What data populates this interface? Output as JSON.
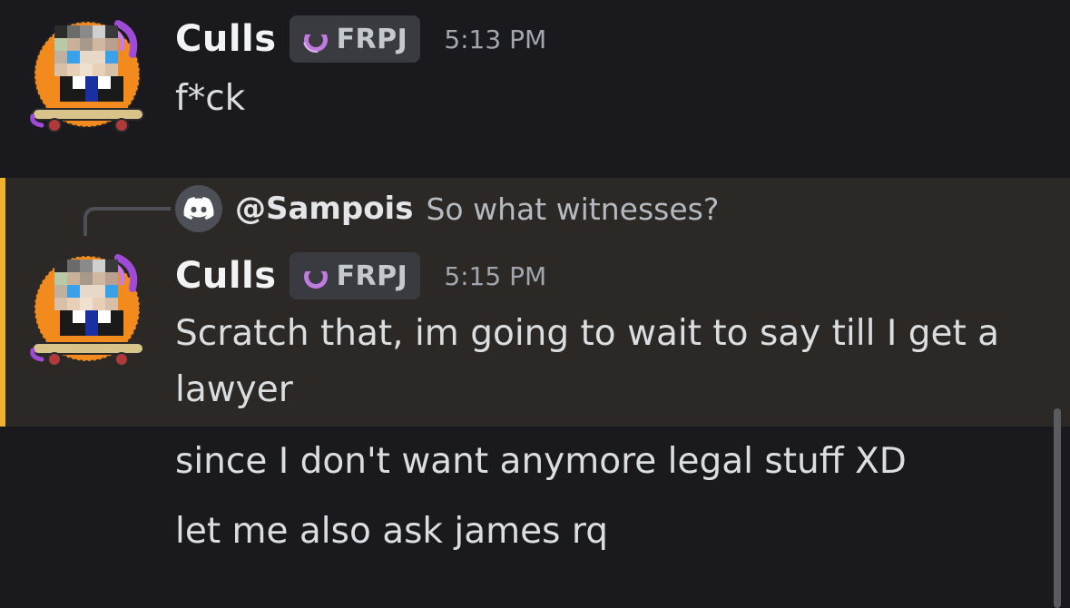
{
  "messages": [
    {
      "author": "Culls",
      "tag": "FRPJ",
      "timestamp": "5:13 PM",
      "text": "f*ck"
    },
    {
      "reply_to": {
        "mention": "@Sampois",
        "preview": "So what witnesses?",
        "avatar_icon": "discord-logo-icon"
      },
      "author": "Culls",
      "tag": "FRPJ",
      "timestamp": "5:15 PM",
      "text": "Scratch that, im going to wait to say till I get a lawyer",
      "highlight_color": "#f0b232"
    }
  ],
  "continuation_messages": [
    "since I don't want anymore legal stuff XD",
    "let me also ask james rq"
  ],
  "colors": {
    "background": "#1a1a1e",
    "highlight_background": "#2c2825",
    "highlight_bar": "#f0b232",
    "tag_badge": "#3a3b40"
  }
}
